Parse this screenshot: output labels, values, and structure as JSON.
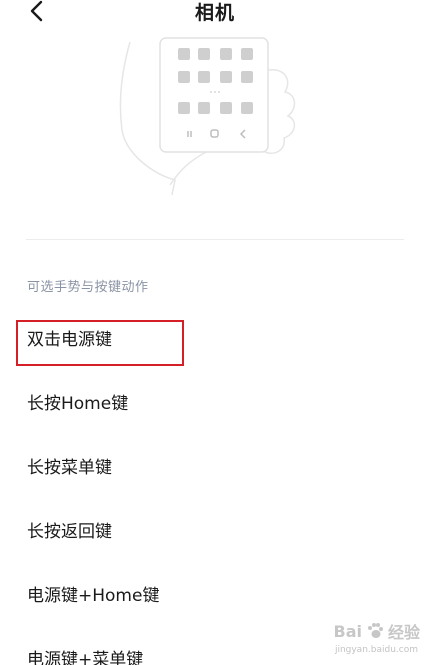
{
  "header": {
    "title": "相机"
  },
  "section": {
    "label": "可选手势与按键动作"
  },
  "options": [
    {
      "label": "双击电源键",
      "selected": true
    },
    {
      "label": "长按Home键"
    },
    {
      "label": "长按菜单键"
    },
    {
      "label": "长按返回键"
    },
    {
      "label": "电源键+Home键"
    },
    {
      "label": "电源键+菜单键"
    }
  ],
  "watermark": {
    "text": "Bai",
    "text2": "经验",
    "sub": "jingyan.baidu.com"
  },
  "colors": {
    "highlight": "#d41f26",
    "section_label": "#8a93a5"
  }
}
